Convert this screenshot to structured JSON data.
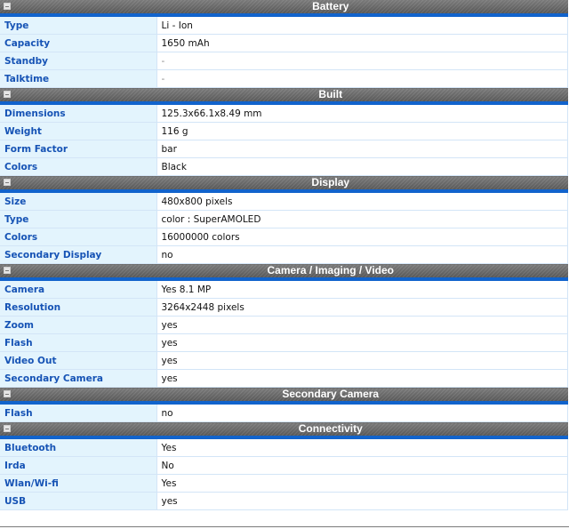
{
  "sections": [
    {
      "title": "Battery",
      "rows": [
        {
          "label": "Type",
          "value": "Li - Ion"
        },
        {
          "label": "Capacity",
          "value": "1650 mAh"
        },
        {
          "label": "Standby",
          "value": "-"
        },
        {
          "label": "Talktime",
          "value": "-"
        }
      ]
    },
    {
      "title": "Built",
      "rows": [
        {
          "label": "Dimensions",
          "value": "125.3x66.1x8.49 mm"
        },
        {
          "label": "Weight",
          "value": "116 g"
        },
        {
          "label": "Form Factor",
          "value": "bar"
        },
        {
          "label": "Colors",
          "value": "Black"
        }
      ]
    },
    {
      "title": "Display",
      "rows": [
        {
          "label": "Size",
          "value": "480x800 pixels"
        },
        {
          "label": "Type",
          "value": "color : SuperAMOLED"
        },
        {
          "label": "Colors",
          "value": "16000000 colors"
        },
        {
          "label": "Secondary Display",
          "value": "no"
        }
      ]
    },
    {
      "title": "Camera / Imaging / Video",
      "rows": [
        {
          "label": "Camera",
          "value": "Yes 8.1 MP"
        },
        {
          "label": "Resolution",
          "value": "3264x2448 pixels"
        },
        {
          "label": "Zoom",
          "value": "yes"
        },
        {
          "label": "Flash",
          "value": "yes"
        },
        {
          "label": "Video Out",
          "value": "yes"
        },
        {
          "label": "Secondary Camera",
          "value": "yes"
        }
      ]
    },
    {
      "title": "Secondary Camera",
      "rows": [
        {
          "label": "Flash",
          "value": "no"
        }
      ]
    },
    {
      "title": "Connectivity",
      "rows": [
        {
          "label": "Bluetooth",
          "value": "Yes"
        },
        {
          "label": "Irda",
          "value": "No"
        },
        {
          "label": "Wlan/Wi-fi",
          "value": "Yes"
        },
        {
          "label": "USB",
          "value": "yes"
        }
      ]
    }
  ],
  "icons": {
    "section_toggle": "collapse-minus-icon"
  },
  "colors": {
    "header_bg": "#6e6e6e",
    "header_accent": "#1163cc",
    "label_bg": "#e3f4fd",
    "label_text": "#1653b5"
  }
}
